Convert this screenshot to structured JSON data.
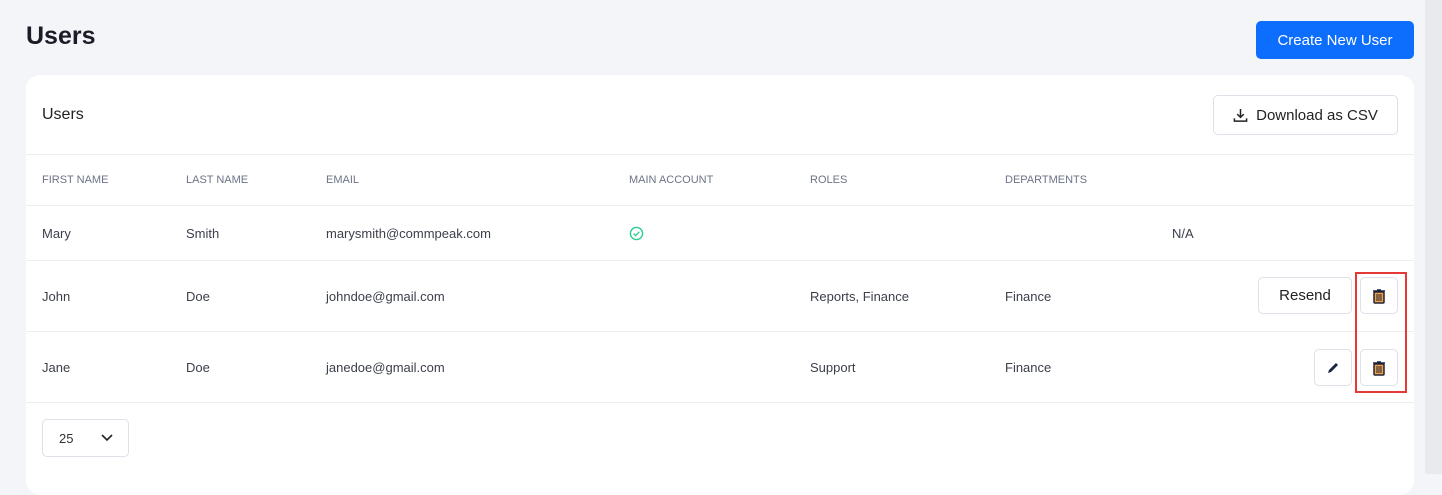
{
  "page": {
    "title": "Users",
    "create_button": "Create New User"
  },
  "card": {
    "title": "Users",
    "download_button": "Download as CSV"
  },
  "columns": [
    "FIRST NAME",
    "LAST NAME",
    "EMAIL",
    "MAIN ACCOUNT",
    "ROLES",
    "DEPARTMENTS"
  ],
  "rows": [
    {
      "first": "Mary",
      "last": "Smith",
      "email": "marysmith@commpeak.com",
      "main_account": true,
      "roles": "",
      "departments": "",
      "extra": "N/A"
    },
    {
      "first": "John",
      "last": "Doe",
      "email": "johndoe@gmail.com",
      "main_account": false,
      "roles": "Reports, Finance",
      "departments": "Finance",
      "action": "Resend"
    },
    {
      "first": "Jane",
      "last": "Doe",
      "email": "janedoe@gmail.com",
      "main_account": false,
      "roles": "Support",
      "departments": "Finance"
    }
  ],
  "pagination": {
    "page_size": "25"
  },
  "colors": {
    "primary": "#0d6efd",
    "check": "#2ecc8f",
    "highlight": "#e53935"
  }
}
